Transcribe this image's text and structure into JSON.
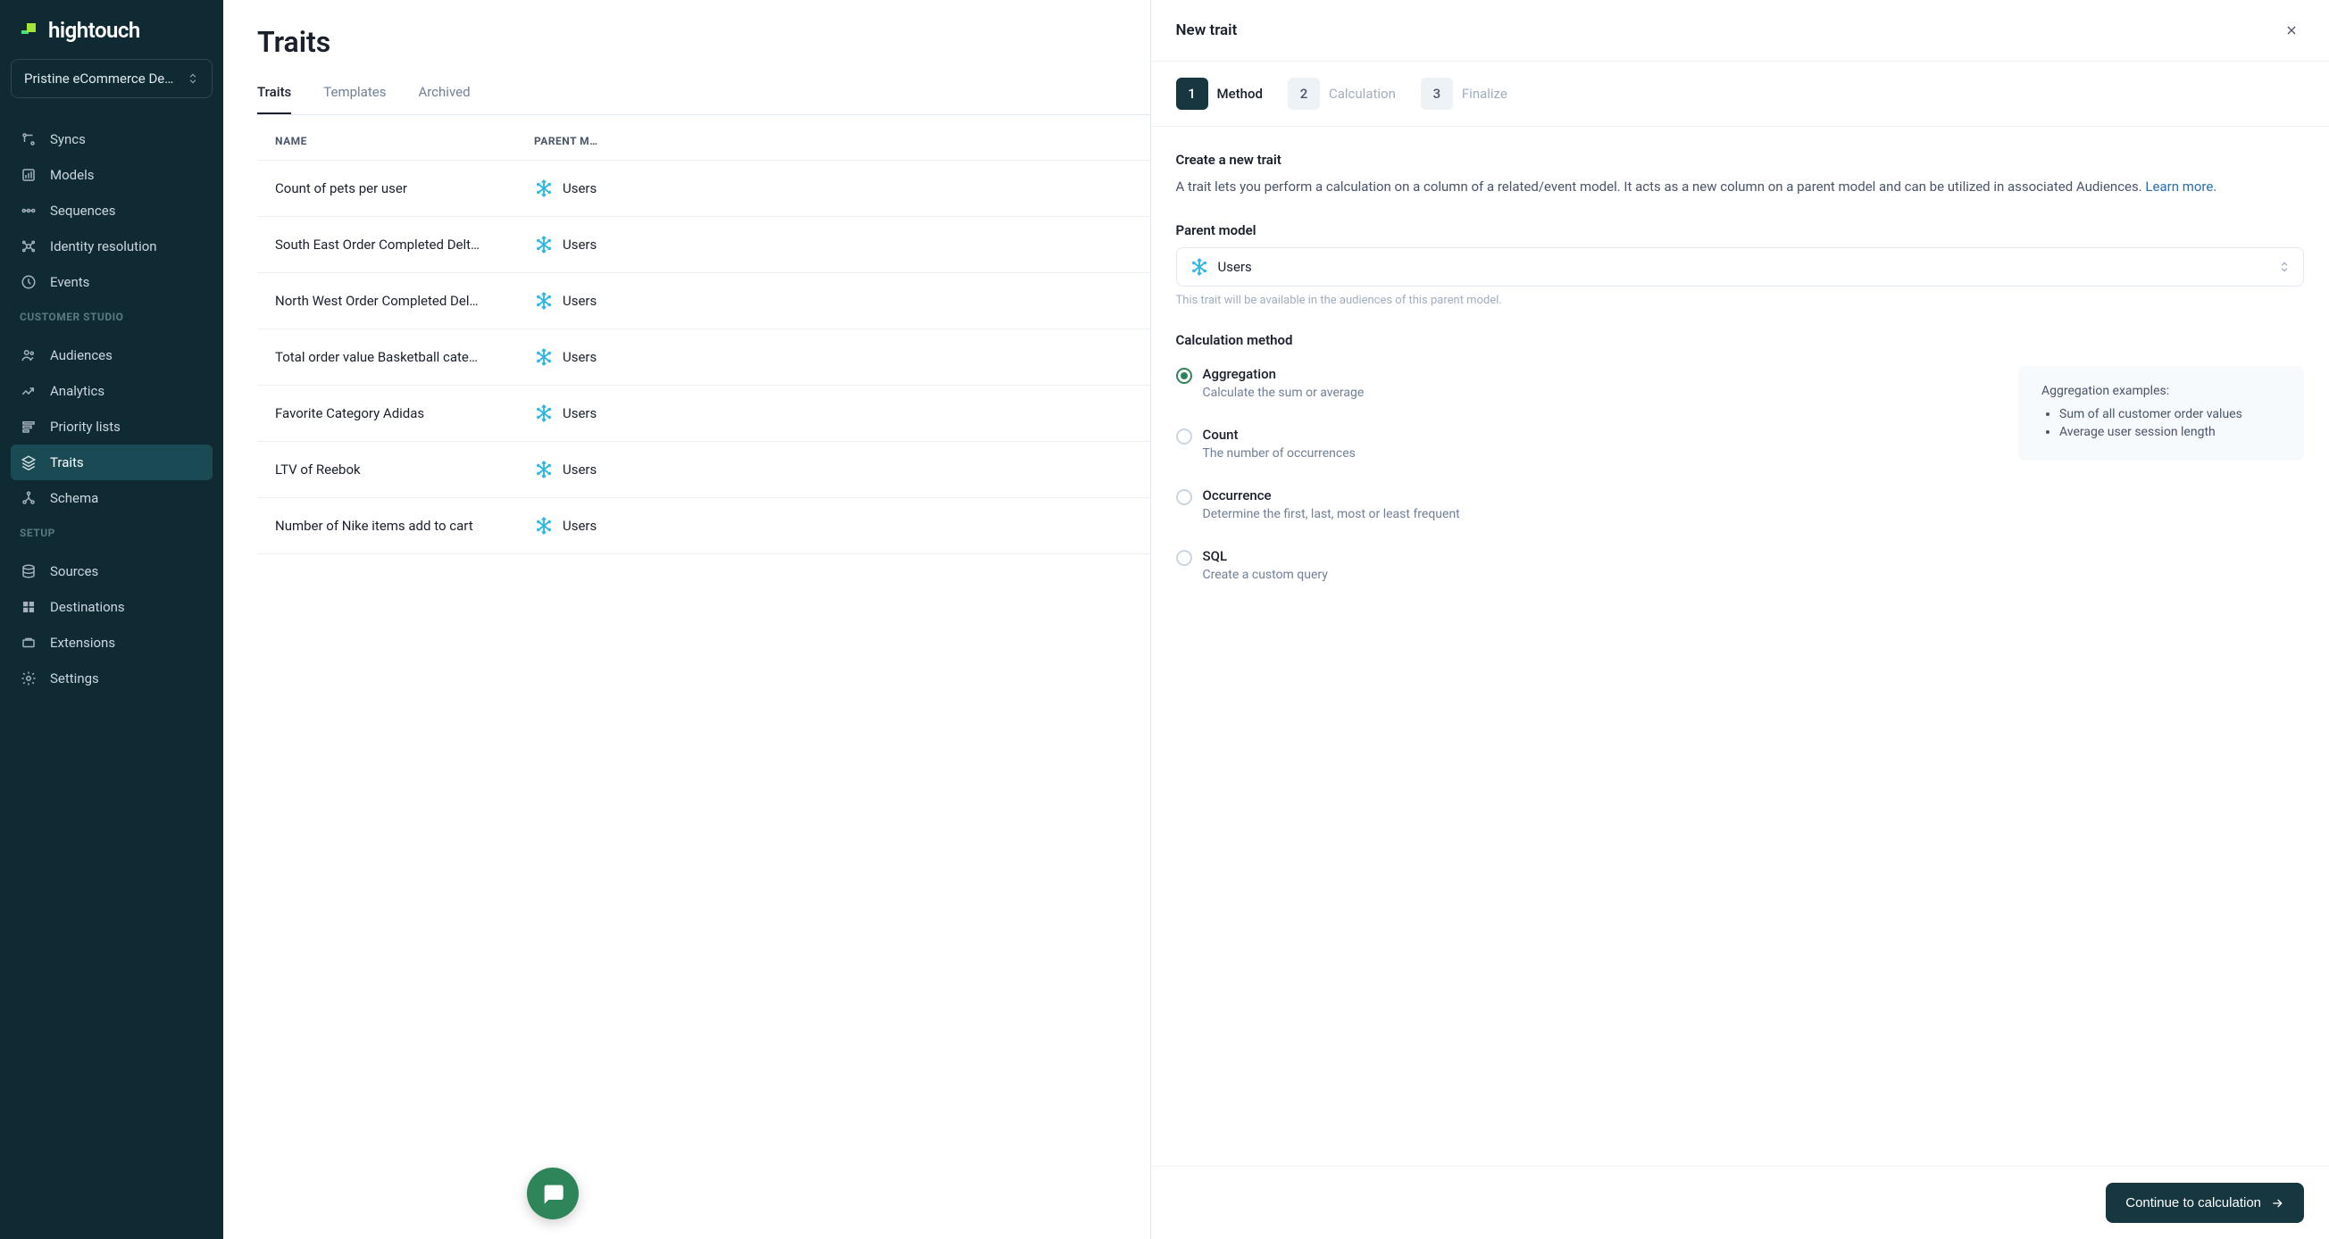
{
  "brand": "hightouch",
  "workspace": {
    "name": "Pristine eCommerce De…"
  },
  "nav": {
    "top": [
      {
        "label": "Syncs"
      },
      {
        "label": "Models"
      },
      {
        "label": "Sequences"
      },
      {
        "label": "Identity resolution"
      },
      {
        "label": "Events"
      }
    ],
    "customerStudioHeading": "CUSTOMER STUDIO",
    "customerStudio": [
      {
        "label": "Audiences"
      },
      {
        "label": "Analytics"
      },
      {
        "label": "Priority lists"
      },
      {
        "label": "Traits"
      },
      {
        "label": "Schema"
      }
    ],
    "setupHeading": "SETUP",
    "setup": [
      {
        "label": "Sources"
      },
      {
        "label": "Destinations"
      },
      {
        "label": "Extensions"
      },
      {
        "label": "Settings"
      }
    ]
  },
  "page": {
    "title": "Traits",
    "tabs": {
      "traits": "Traits",
      "templates": "Templates",
      "archived": "Archived"
    },
    "columns": {
      "name": "NAME",
      "parent": "PARENT M…"
    },
    "rows": [
      {
        "name": "Count of pets per user",
        "parent": "Users"
      },
      {
        "name": "South East Order Completed Delt…",
        "parent": "Users"
      },
      {
        "name": "North West Order Completed Del…",
        "parent": "Users"
      },
      {
        "name": "Total order value Basketball cate…",
        "parent": "Users"
      },
      {
        "name": "Favorite Category Adidas",
        "parent": "Users"
      },
      {
        "name": "LTV of Reebok",
        "parent": "Users"
      },
      {
        "name": "Number of Nike items add to cart",
        "parent": "Users"
      }
    ]
  },
  "drawer": {
    "title": "New trait",
    "steps": {
      "1": "Method",
      "2": "Calculation",
      "3": "Finalize"
    },
    "createTitle": "Create a new trait",
    "createDesc": "A trait lets you perform a calculation on a column of a related/event model. It acts as a new column on a parent model and can be utilized in associated Audiences. ",
    "learnMore": "Learn more.",
    "parentModelLabel": "Parent model",
    "parentModelValue": "Users",
    "parentModelHint": "This trait will be available in the audiences of this parent model.",
    "calcMethodLabel": "Calculation method",
    "methods": {
      "aggregation": {
        "title": "Aggregation",
        "desc": "Calculate the sum or average"
      },
      "count": {
        "title": "Count",
        "desc": "The number of occurrences"
      },
      "occurrence": {
        "title": "Occurrence",
        "desc": "Determine the first, last, most or least frequent"
      },
      "sql": {
        "title": "SQL",
        "desc": "Create a custom query"
      }
    },
    "examples": {
      "title": "Aggregation examples:",
      "items": [
        "Sum of all customer order values",
        "Average user session length"
      ]
    },
    "continueBtn": "Continue to calculation"
  }
}
